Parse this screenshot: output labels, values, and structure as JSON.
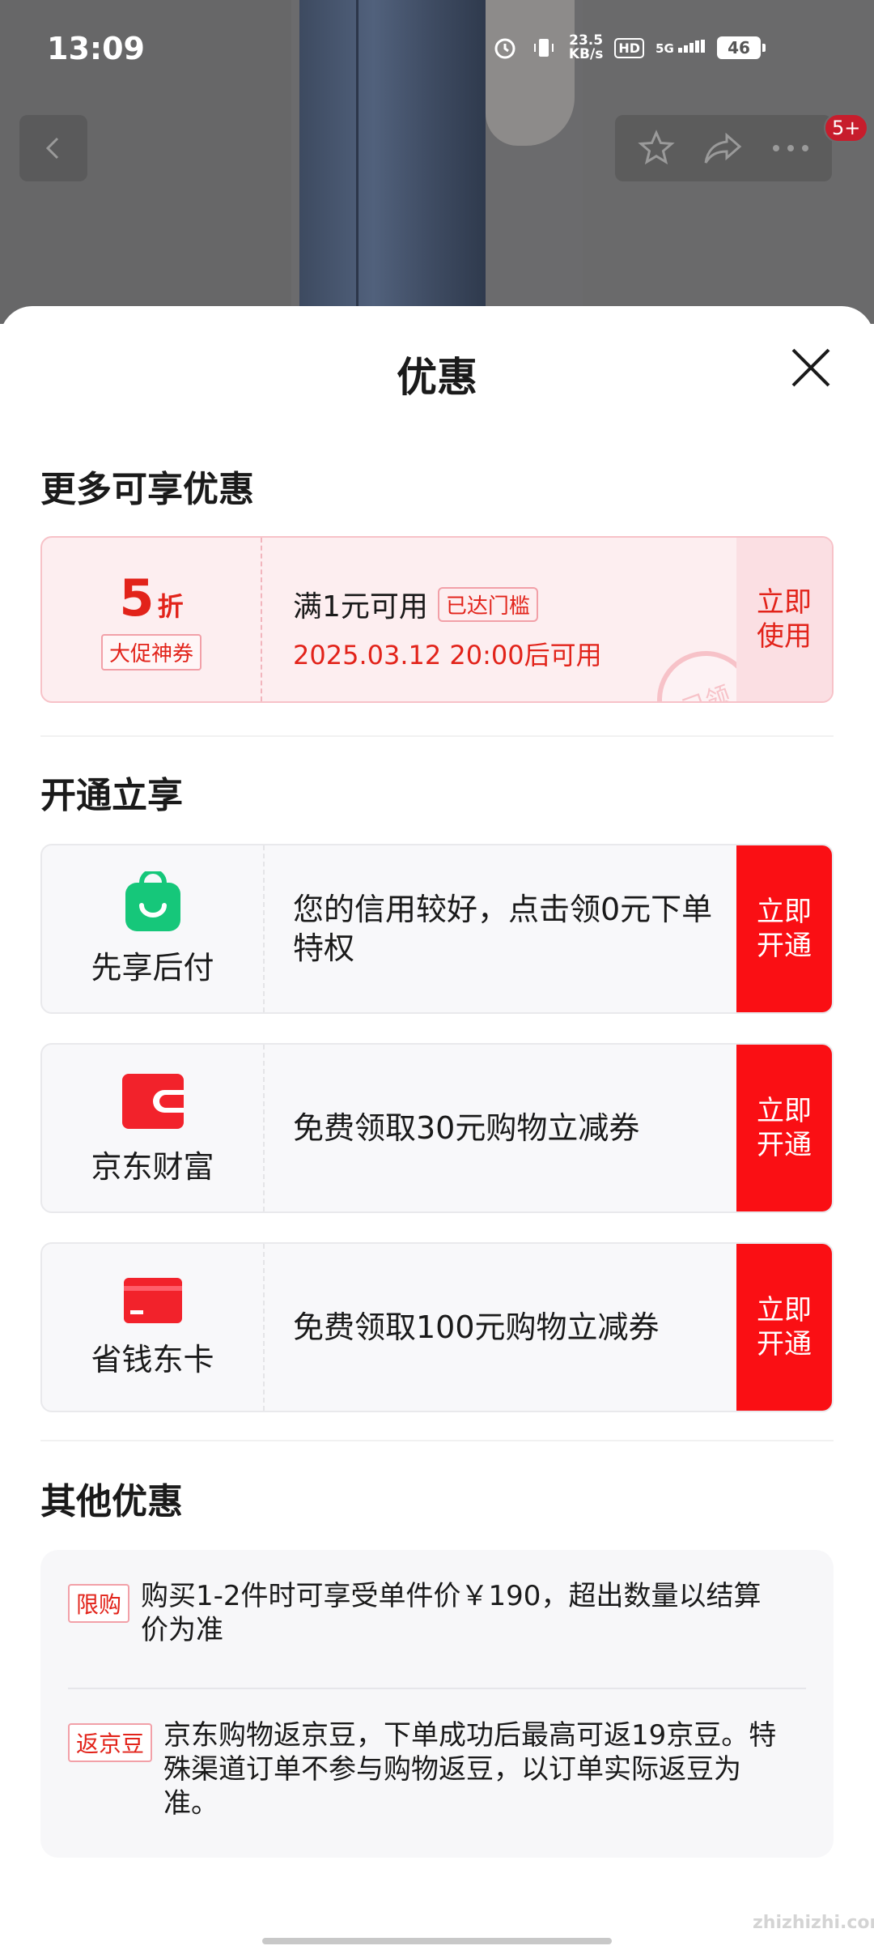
{
  "status_bar": {
    "time": "13:09",
    "net_speed": "23.5",
    "net_unit": "KB/s",
    "hd": "HD",
    "signal": "5G",
    "battery": "46"
  },
  "product_nav": {
    "cart_badge": "5+"
  },
  "sheet": {
    "title": "优惠"
  },
  "more_offers": {
    "title": "更多可享优惠",
    "coupon": {
      "discount_num": "5",
      "discount_unit": "折",
      "tag": "大促神券",
      "condition": "满1元可用",
      "threshold_badge": "已达门槛",
      "valid_time": "2025.03.12 20:00后可用",
      "use_label": "立即\n使用",
      "stamp": "已领"
    }
  },
  "open_enjoy": {
    "title": "开通立享",
    "items": [
      {
        "name": "先享后付",
        "desc": "您的信用较好，点击领0元下单特权",
        "action": "立即开通",
        "icon": "shopping-bag-icon",
        "color": "#16c77a"
      },
      {
        "name": "京东财富",
        "desc": "免费领取30元购物立减券",
        "action": "立即开通",
        "icon": "wallet-icon",
        "color": "#f2222b"
      },
      {
        "name": "省钱东卡",
        "desc": "免费领取100元购物立减券",
        "action": "立即开通",
        "icon": "card-icon",
        "color": "#f2222b"
      }
    ]
  },
  "other_offers": {
    "title": "其他优惠",
    "items": [
      {
        "tag": "限购",
        "text": "购买1-2件时可享受单件价￥190，超出数量以结算价为准"
      },
      {
        "tag": "返京豆",
        "text": "京东购物返京豆，下单成功后最高可返19京豆。特殊渠道订单不参与购物返豆，以订单实际返豆为准。"
      }
    ]
  },
  "watermark": "zhizhizhi.com",
  "colors": {
    "accent_red": "#e2231a",
    "button_red": "#fa0f14",
    "coupon_bg": "#fdeef0"
  }
}
